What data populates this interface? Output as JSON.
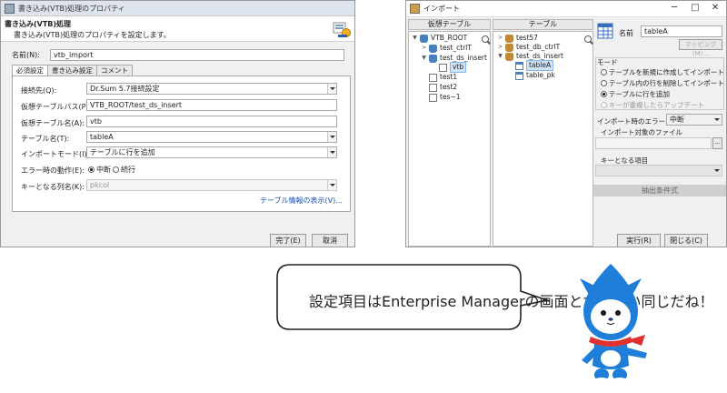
{
  "left_dialog": {
    "title": "書き込み(VTB)処理のプロパティ",
    "header_title": "書き込み(VTB)処理",
    "header_desc": "書き込み(VTB)処理のプロパティを設定します。",
    "name_label": "名前(N):",
    "name_value": "vtb_import",
    "tabs": [
      "必須設定",
      "書き込み設定",
      "コメント"
    ],
    "fields": {
      "connection_label": "接続先(Q):",
      "connection_value": "Dr.Sum 5.7接続設定",
      "vpath_label": "仮想テーブルパス(P):",
      "vpath_value": "VTB_ROOT/test_ds_insert",
      "vname_label": "仮想テーブル名(A):",
      "vname_value": "vtb",
      "table_label": "テーブル名(T):",
      "table_value": "tableA",
      "mode_label": "インポートモード(I):",
      "mode_value": "テーブルに行を追加",
      "error_label": "エラー時の動作(E):",
      "error_opt1": "中断",
      "error_opt2": "続行",
      "key_label": "キーとなる列名(K):",
      "key_value": "pkcol"
    },
    "table_info_link": "テーブル情報の表示(V)...",
    "ok_button": "完了(E)",
    "cancel_button": "取消"
  },
  "right_window": {
    "title": "インポート",
    "vtable_header": "仮想テーブル",
    "table_header": "テーブル",
    "vtree": {
      "root": "VTB_ROOT",
      "items": [
        "test_ctrlT",
        "test_ds_insert",
        "vtb",
        "test1",
        "test2",
        "tes~1"
      ]
    },
    "ttree": {
      "items": [
        "test57",
        "test_db_ctrlT",
        "test_ds_insert",
        "tableA",
        "table_pk"
      ]
    },
    "name_label": "名前",
    "name_value": "tableA",
    "mapping_button": "マッピング(M)...",
    "mode_group_label": "モード",
    "mode_options": [
      "テーブルを新規に作成してインポート",
      "テーブル内の行を削除してインポート",
      "テーブルに行を追加",
      "キーが重複したらアップデート"
    ],
    "error_label": "インポート時のエラー:",
    "error_value": "中断",
    "file_label": "インポート対象のファイル",
    "key_label": "キーとなる項目",
    "extract_button": "抽出条件式",
    "run_button": "実行(R)",
    "close_button": "閉じる(C)"
  },
  "speech_bubble": {
    "text": "設定項目はEnterprise Managerの画面とだいたい同じだね！"
  },
  "colors": {
    "accent_blue": "#1a4fb8",
    "mascot_blue": "#1f7fd8",
    "scarf_red": "#e03030"
  }
}
